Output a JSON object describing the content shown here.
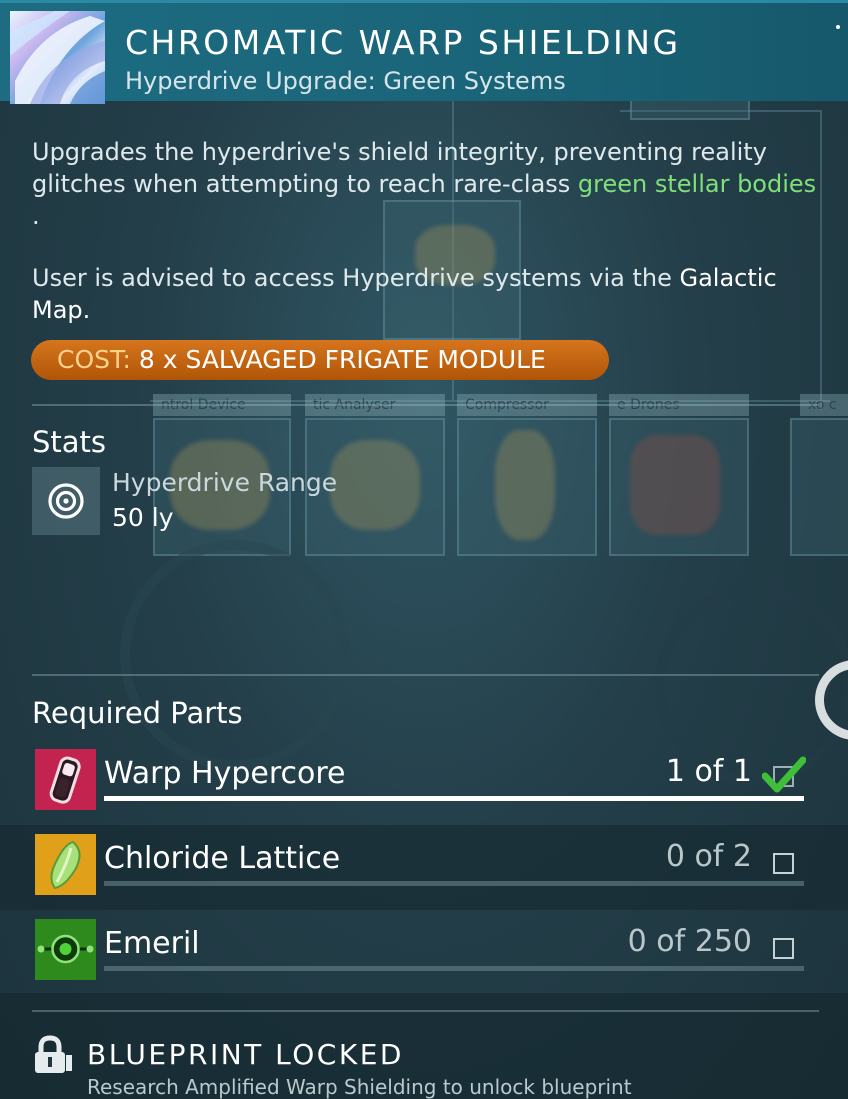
{
  "header": {
    "title": "CHROMATIC WARP SHIELDING",
    "subtitle": "Hyperdrive Upgrade: Green Systems"
  },
  "description": {
    "line_part1": "Upgrades the hyperdrive's shield integrity, preventing reality glitches when attempting to reach rare-class ",
    "highlight": "green stellar bodies",
    "line_end": ".",
    "advice_part1": "User is advised to access Hyperdrive systems via the ",
    "advice_highlight": "Galactic",
    "advice_end": "Map."
  },
  "cost": {
    "label": "COST:",
    "value": "8 x SALVAGED FRIGATE MODULE"
  },
  "background_tags": [
    "ntrol Device",
    "tic Analyser",
    "Compressor",
    "e Drones",
    "xo c"
  ],
  "stats": {
    "title": "Stats",
    "items": [
      {
        "label": "Hyperdrive Range",
        "value": "50 ly",
        "icon": "target-icon"
      }
    ]
  },
  "required_parts": {
    "title": "Required Parts",
    "items": [
      {
        "name": "Warp Hypercore",
        "quantity": "1 of 1",
        "have": 1,
        "need": 1,
        "complete": true,
        "icon": "warp-hypercore-icon",
        "icon_color": "#c2234f"
      },
      {
        "name": "Chloride Lattice",
        "quantity": "0 of 2",
        "have": 0,
        "need": 2,
        "complete": false,
        "icon": "chloride-lattice-icon",
        "icon_color": "#e1a01a"
      },
      {
        "name": "Emeril",
        "quantity": "0 of 250",
        "have": 0,
        "need": 250,
        "complete": false,
        "icon": "emeril-icon",
        "icon_color": "#2f8a1e"
      }
    ]
  },
  "footer": {
    "title": "BLUEPRINT LOCKED",
    "subtitle": "Research Amplified Warp Shielding to unlock blueprint"
  },
  "colors": {
    "header_bg": "#1d6c82",
    "accent_green": "#7fe07a",
    "cost_orange": "#d6751d",
    "check_green": "#3fbe3a"
  }
}
